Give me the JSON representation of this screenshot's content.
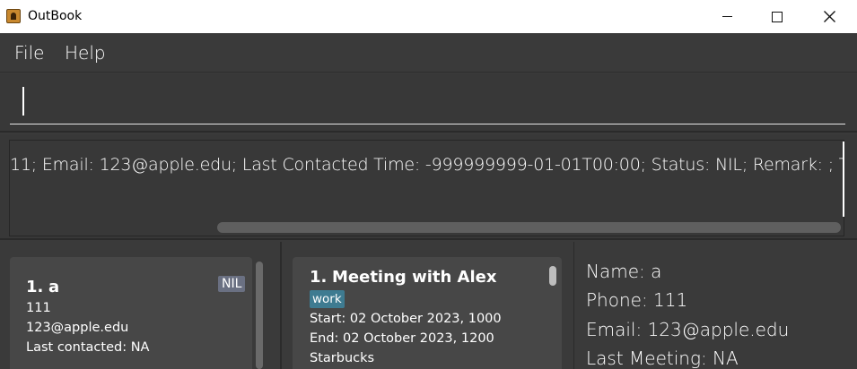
{
  "window": {
    "title": "OutBook"
  },
  "menu": {
    "file": "File",
    "help": "Help"
  },
  "command": {
    "value": ""
  },
  "result": {
    "text": "11; Email: 123@apple.edu; Last Contacted Time: -999999999-01-01T00:00; Status: NIL; Remark: ; Tags:"
  },
  "persons": [
    {
      "index": "1.",
      "name": "a",
      "status": "NIL",
      "phone": "111",
      "email": "123@apple.edu",
      "last_contacted": "Last contacted: NA"
    }
  ],
  "meetings": [
    {
      "index": "1.",
      "title": "Meeting with Alex",
      "tag": "work",
      "start": "Start: 02 October 2023, 1000",
      "end": "End: 02 October 2023, 1200",
      "location": "Starbucks"
    }
  ],
  "details": {
    "name": "Name: a",
    "phone": "Phone: 111",
    "email": "Email: 123@apple.edu",
    "last_meeting": "Last Meeting: NA"
  },
  "colors": {
    "background": "#3a3a3a",
    "card": "#474747",
    "nil_badge": "#6a7082",
    "work_tag": "#3e7b91"
  }
}
